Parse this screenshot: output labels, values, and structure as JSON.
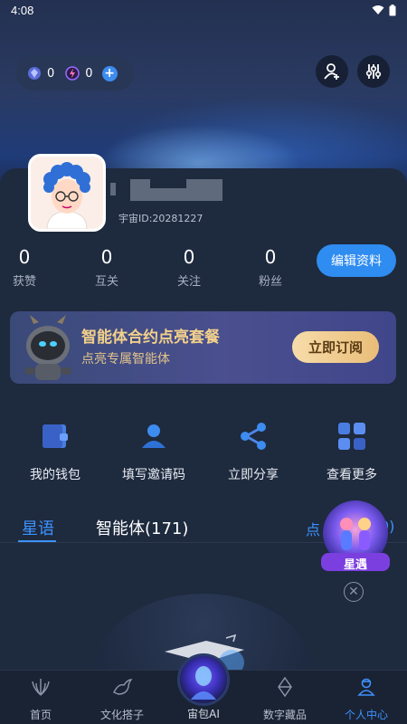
{
  "status_bar": {
    "time": "4:08"
  },
  "header": {
    "gems": "0",
    "energy": "0",
    "plus": "+"
  },
  "profile": {
    "uid": "宇宙ID:20281227"
  },
  "stats": [
    {
      "value": "0",
      "label": "获赞"
    },
    {
      "value": "0",
      "label": "互关"
    },
    {
      "value": "0",
      "label": "关注"
    },
    {
      "value": "0",
      "label": "粉丝"
    }
  ],
  "edit_profile": "编辑资料",
  "banner": {
    "title": "智能体合约点亮套餐",
    "subtitle": "点亮专属智能体",
    "cta": "立即订阅"
  },
  "actions": [
    {
      "label": "我的钱包",
      "icon": "wallet-icon"
    },
    {
      "label": "填写邀请码",
      "icon": "user-invite-icon"
    },
    {
      "label": "立即分享",
      "icon": "share-icon"
    },
    {
      "label": "查看更多",
      "icon": "grid-icon"
    }
  ],
  "tabs": {
    "tab1": "星语",
    "tab2": "智能体(171)",
    "right_partial": "点",
    "right_partial_end": "0)"
  },
  "float_badge": {
    "label": "星遇",
    "close": "✕"
  },
  "bottom_nav": [
    {
      "label": "首页",
      "icon": "home-icon"
    },
    {
      "label": "文化搭子",
      "icon": "bird-icon"
    },
    {
      "label": "宙包AI",
      "icon": "ai-avatar-icon"
    },
    {
      "label": "数字藏品",
      "icon": "diamond-icon"
    },
    {
      "label": "个人中心",
      "icon": "profile-icon",
      "active": true
    }
  ],
  "colors": {
    "accent": "#3d92ff",
    "gold": "#f2d08a",
    "card_bg": "#1e2a3e"
  }
}
